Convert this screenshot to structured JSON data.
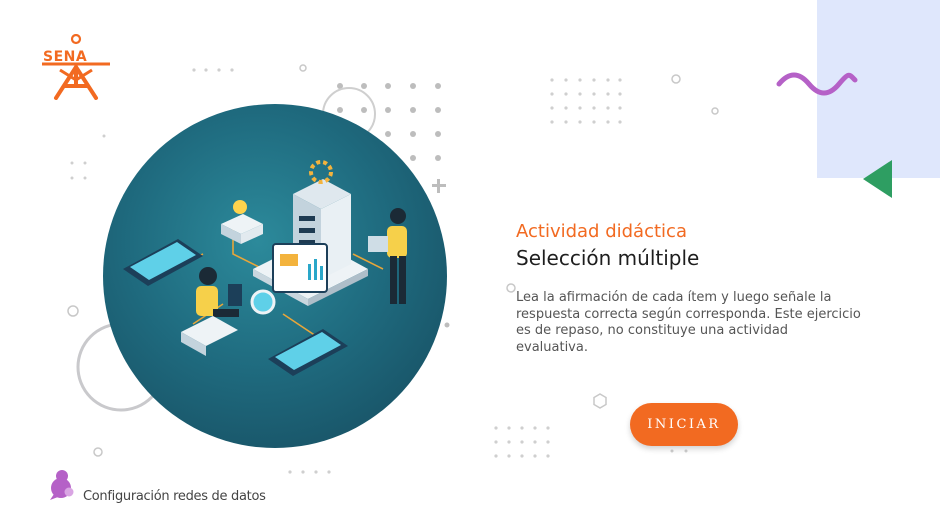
{
  "brand": {
    "logo_text": "SENA"
  },
  "activity": {
    "kicker": "Actividad didáctica",
    "type": "Selección múltiple",
    "description": "Lea la afirmación de cada ítem y luego señale la respuesta correcta según corresponda.  Este ejercicio es de repaso, no constituye una actividad evaluativa.",
    "start_button_label": "INICIAR"
  },
  "footer": {
    "course_name": "Configuración redes de datos"
  },
  "colors": {
    "accent": "#f26a21",
    "panel": "#dfe7fc",
    "wave": "#b561c7",
    "triangle": "#2e9e62"
  },
  "icons": [
    "sena-logo",
    "puzzle-icon",
    "wave-icon",
    "triangle-icon",
    "plus-icon"
  ]
}
